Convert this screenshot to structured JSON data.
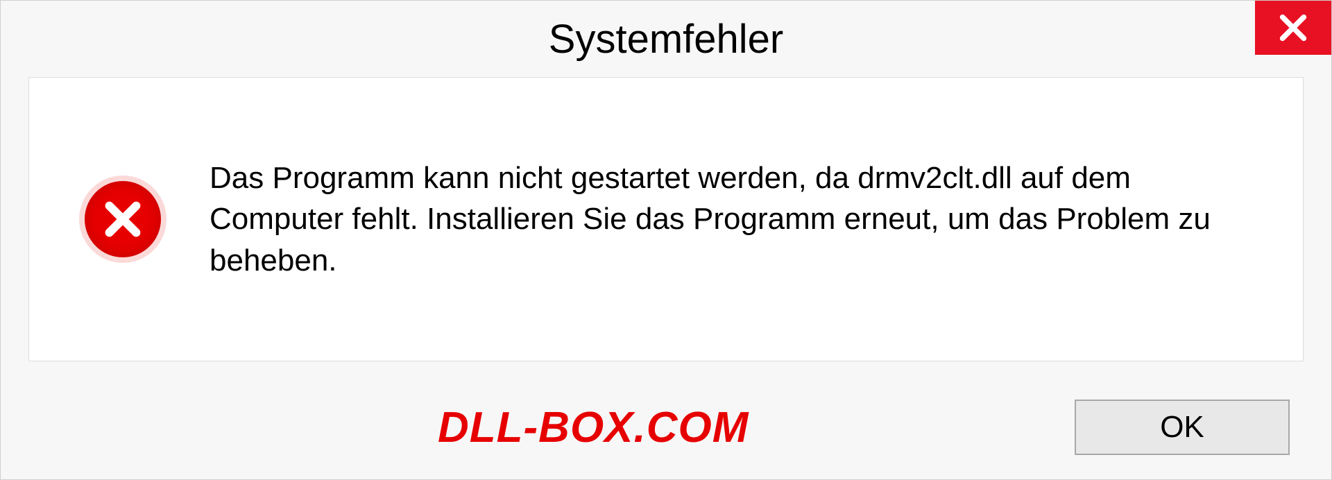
{
  "dialog": {
    "title": "Systemfehler",
    "message": "Das Programm kann nicht gestartet werden, da drmv2clt.dll auf dem Computer fehlt. Installieren Sie das Programm erneut, um das Problem zu beheben.",
    "ok_label": "OK"
  },
  "watermark": "DLL-BOX.COM"
}
